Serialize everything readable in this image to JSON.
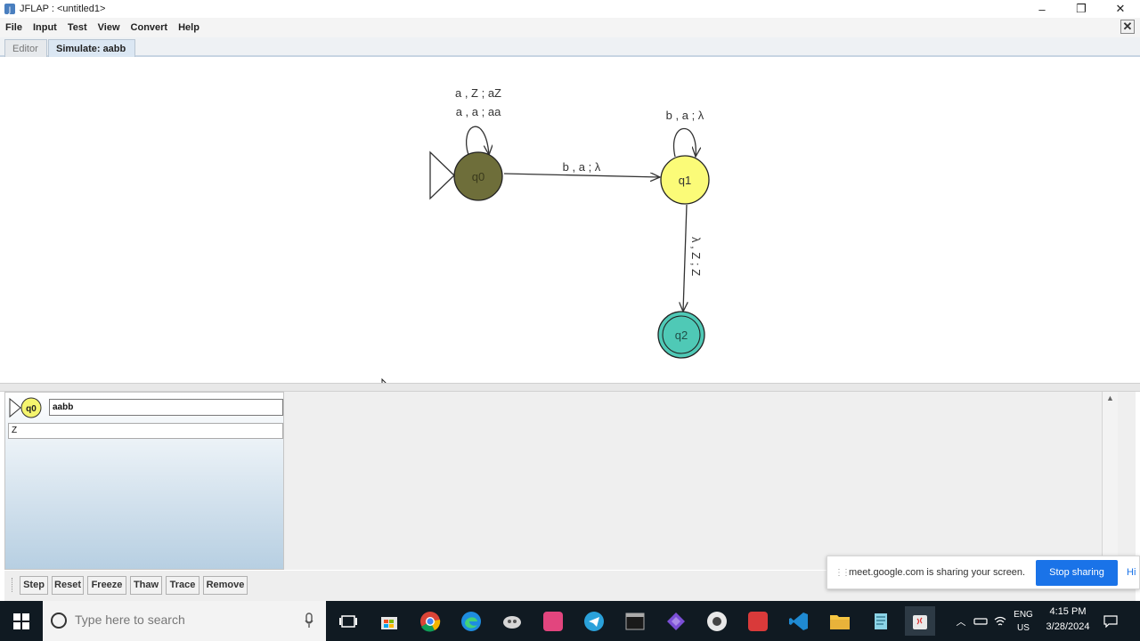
{
  "window": {
    "title": "JFLAP : <untitled1>",
    "minimize": "–",
    "maximize": "❐",
    "close": "✕"
  },
  "menu": [
    "File",
    "Input",
    "Test",
    "View",
    "Convert",
    "Help"
  ],
  "doc_close": "✕",
  "tabs": [
    {
      "label": "Editor",
      "active": false
    },
    {
      "label": "Simulate: aabb",
      "active": true
    }
  ],
  "automaton": {
    "states": [
      {
        "id": "q0",
        "label": "q0",
        "initial": true,
        "final": false,
        "color": "#6e6e3a"
      },
      {
        "id": "q1",
        "label": "q1",
        "initial": false,
        "final": false,
        "color": "#fbfb78"
      },
      {
        "id": "q2",
        "label": "q2",
        "initial": false,
        "final": true,
        "color": "#4fc9b6"
      }
    ],
    "transitions": {
      "q0_loop_1": "a , Z ; aZ",
      "q0_loop_2": "a , a ; aa",
      "q0_q1": "b , a ; λ",
      "q1_loop": "b , a ; λ",
      "q1_q2": "λ , Z ; Z"
    }
  },
  "simulation": {
    "state": "q0",
    "input": "aabb",
    "stack": "Z",
    "current_state_color": "#f5f56e"
  },
  "sim_buttons": [
    "Step",
    "Reset",
    "Freeze",
    "Thaw",
    "Trace",
    "Remove"
  ],
  "meet_banner": {
    "message": "meet.google.com is sharing your screen.",
    "stop_button": "Stop sharing",
    "hide_link": "Hi"
  },
  "taskbar": {
    "search_placeholder": "Type here to search",
    "lang_top": "ENG",
    "lang_bottom": "US",
    "time": "4:15 PM",
    "date": "3/28/2024"
  }
}
